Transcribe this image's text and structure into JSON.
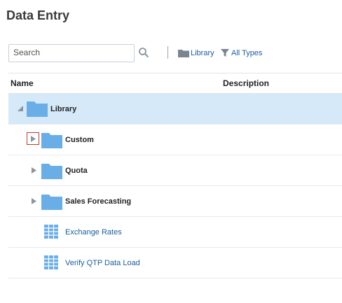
{
  "page": {
    "title": "Data Entry"
  },
  "toolbar": {
    "search_placeholder": "Search",
    "library_label": "Library",
    "filter_label": "All Types"
  },
  "table": {
    "columns": {
      "name": "Name",
      "description": "Description"
    },
    "rows": [
      {
        "label": "Library",
        "type": "folder",
        "state": "expanded",
        "description": ""
      },
      {
        "label": "Custom",
        "type": "folder",
        "state": "collapsed",
        "description": ""
      },
      {
        "label": "Quota",
        "type": "folder",
        "state": "collapsed",
        "description": ""
      },
      {
        "label": "Sales Forecasting",
        "type": "folder",
        "state": "collapsed",
        "description": ""
      },
      {
        "label": "Exchange Rates",
        "type": "form",
        "description": ""
      },
      {
        "label": "Verify QTP Data Load",
        "type": "form",
        "description": ""
      }
    ]
  },
  "colors": {
    "accent": "#1a5c9c",
    "selected_row": "#d5e9f9",
    "folder": "#6aaee8"
  },
  "icons": {
    "search": "search-icon",
    "folder": "folder-icon",
    "filter": "filter-icon",
    "form": "grid-icon"
  }
}
